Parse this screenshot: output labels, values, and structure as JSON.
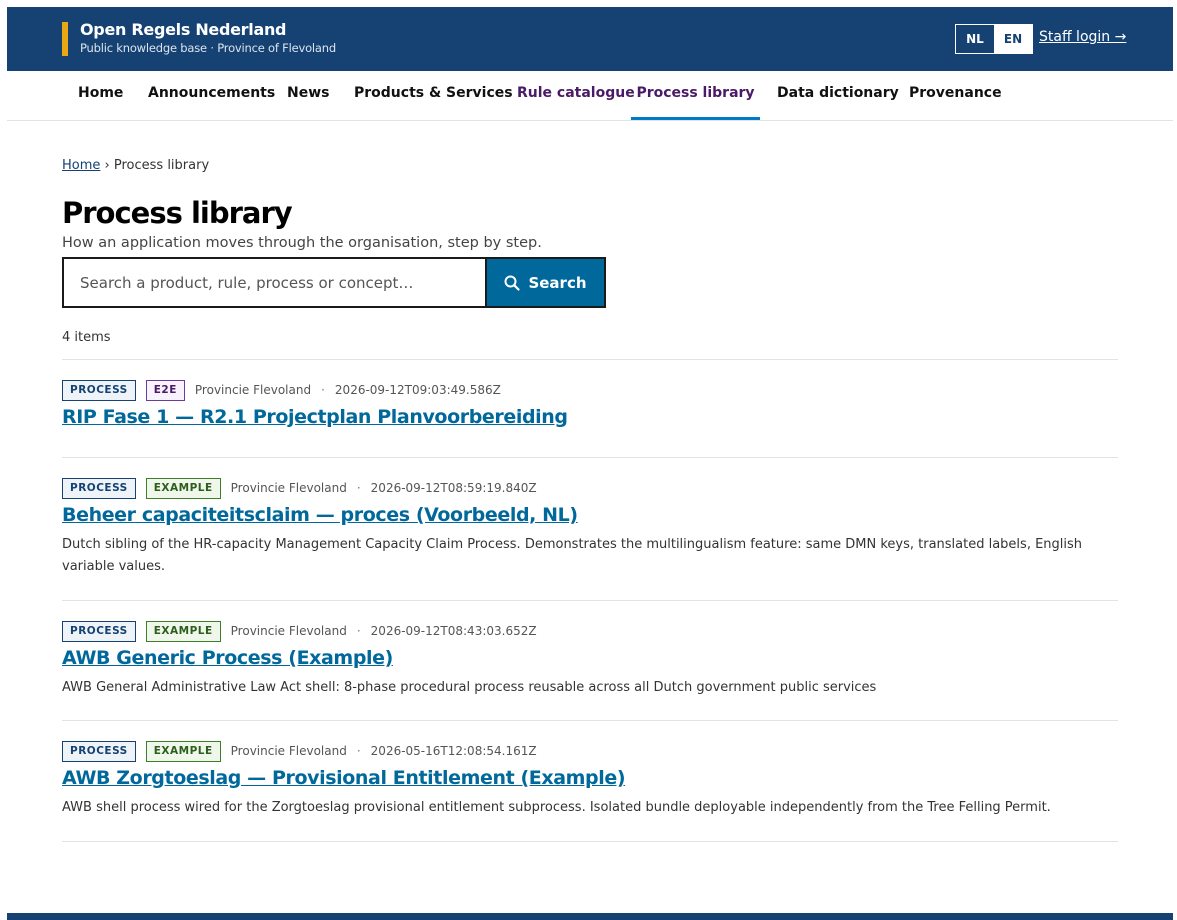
{
  "header": {
    "title": "Open Regels Nederland",
    "subtitle": "Public knowledge base · Province of Flevoland",
    "lang_nl": "NL",
    "lang_en": "EN",
    "staff_login": "Staff login →",
    "colors": {
      "brand": "#154273",
      "accent": "#e9a914"
    }
  },
  "nav": [
    {
      "label": "Home"
    },
    {
      "label": "Announcements"
    },
    {
      "label": "News"
    },
    {
      "label": "Products & Services"
    },
    {
      "label": "Rule catalogue"
    },
    {
      "label": "Process library"
    },
    {
      "label": "Data dictionary"
    },
    {
      "label": "Provenance"
    }
  ],
  "breadcrumb": {
    "home": "Home",
    "separator": "›",
    "current": "Process library"
  },
  "page": {
    "title": "Process library",
    "lead": "How an application moves through the organisation, step by step."
  },
  "search": {
    "placeholder": "Search a product, rule, process or concept…",
    "button": "Search",
    "icon": "search-icon"
  },
  "count": "4 items",
  "items": [
    {
      "badges": [
        "PROCESS",
        "E2E"
      ],
      "org": "Provincie Flevoland",
      "timestamp": "2026-09-12T09:03:49.586Z",
      "title": "RIP Fase 1 — R2.1 Projectplan Planvoorbereiding",
      "description": ""
    },
    {
      "badges": [
        "PROCESS",
        "EXAMPLE"
      ],
      "org": "Provincie Flevoland",
      "timestamp": "2026-09-12T08:59:19.840Z",
      "title": "Beheer capaciteitsclaim — proces (Voorbeeld, NL)",
      "description": "Dutch sibling of the HR-capacity Management Capacity Claim Process. Demonstrates the multilingualism feature: same DMN keys, translated labels, English variable values."
    },
    {
      "badges": [
        "PROCESS",
        "EXAMPLE"
      ],
      "org": "Provincie Flevoland",
      "timestamp": "2026-09-12T08:43:03.652Z",
      "title": "AWB Generic Process (Example)",
      "description": "AWB General Administrative Law Act shell: 8-phase procedural process reusable across all Dutch government public services"
    },
    {
      "badges": [
        "PROCESS",
        "EXAMPLE"
      ],
      "org": "Provincie Flevoland",
      "timestamp": "2026-05-16T12:08:54.161Z",
      "title": "AWB Zorgtoeslag — Provisional Entitlement (Example)",
      "description": "AWB shell process wired for the Zorgtoeslag provisional entitlement subprocess. Isolated bundle deployable independently from the Tree Felling Permit."
    }
  ]
}
